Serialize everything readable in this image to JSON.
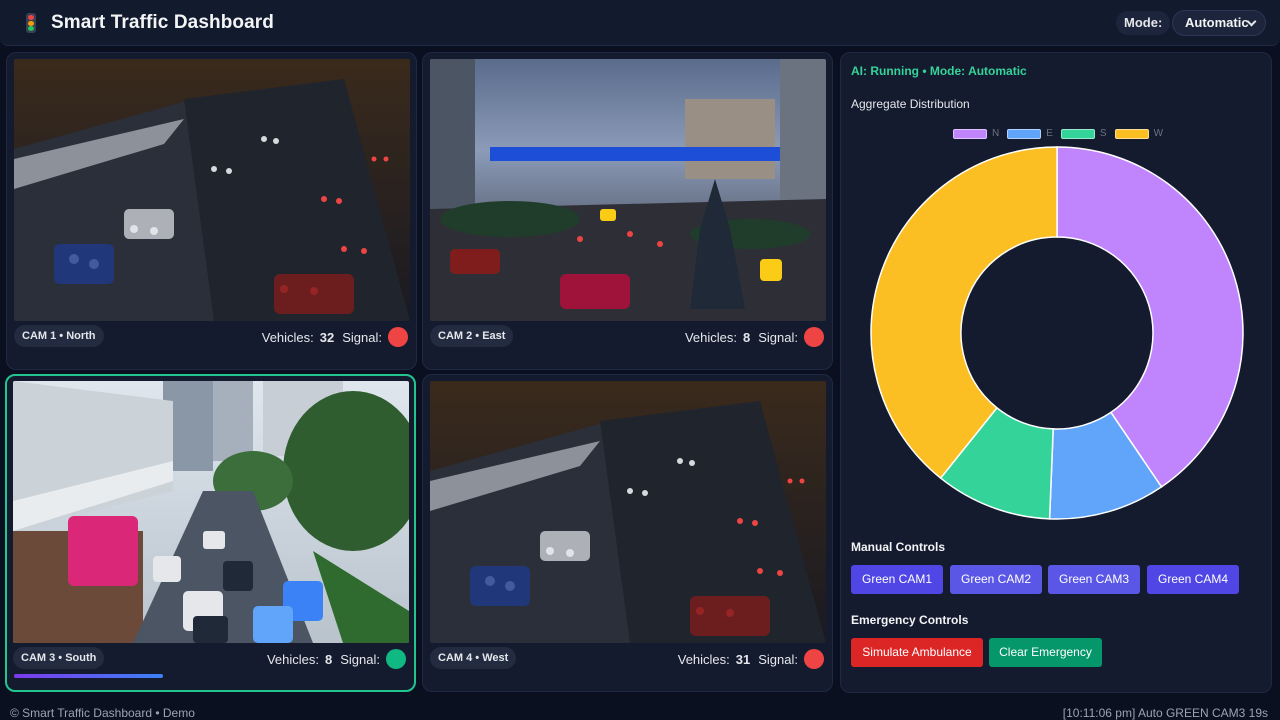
{
  "header": {
    "title": "Smart Traffic Dashboard",
    "mode_label": "Mode:",
    "mode_value": "Automatic"
  },
  "cameras": [
    {
      "label": "CAM 1 • North",
      "vehicles_label": "Vehicles:",
      "vehicles": "32",
      "signal_label": "Signal:",
      "signal_state": "red",
      "signal_color": "#ef4444"
    },
    {
      "label": "CAM 2 • East",
      "vehicles_label": "Vehicles:",
      "vehicles": "8",
      "signal_label": "Signal:",
      "signal_state": "red",
      "signal_color": "#ef4444"
    },
    {
      "label": "CAM 3 • South",
      "vehicles_label": "Vehicles:",
      "vehicles": "8",
      "signal_label": "Signal:",
      "signal_state": "green",
      "signal_color": "#10b981",
      "green_progress": 0.37
    },
    {
      "label": "CAM 4 • West",
      "vehicles_label": "Vehicles:",
      "vehicles": "31",
      "signal_label": "Signal:",
      "signal_state": "red",
      "signal_color": "#ef4444"
    }
  ],
  "panel": {
    "ai_status": "AI: Running • Mode: Automatic",
    "aggregate_title": "Aggregate Distribution",
    "manual_title": "Manual Controls",
    "manual_buttons": [
      "Green CAM1",
      "Green CAM2",
      "Green CAM3",
      "Green CAM4"
    ],
    "emergency_title": "Emergency Controls",
    "simulate_label": "Simulate Ambulance",
    "clear_label": "Clear Emergency"
  },
  "chart_data": {
    "type": "pie",
    "style": "donut",
    "legend_position": "top",
    "categories": [
      "N",
      "E",
      "S",
      "W"
    ],
    "values": [
      32,
      8,
      8,
      31
    ],
    "colors": [
      "#c084fc",
      "#60a5fa",
      "#34d399",
      "#fbbf24"
    ]
  },
  "footer": {
    "left": "© Smart Traffic Dashboard • Demo",
    "right": "[10:11:06 pm] Auto GREEN CAM3 19s"
  },
  "colors": {
    "accent": "#4f46e5",
    "active_border": "#22c58e",
    "danger": "#dc2626",
    "success": "#059669"
  }
}
